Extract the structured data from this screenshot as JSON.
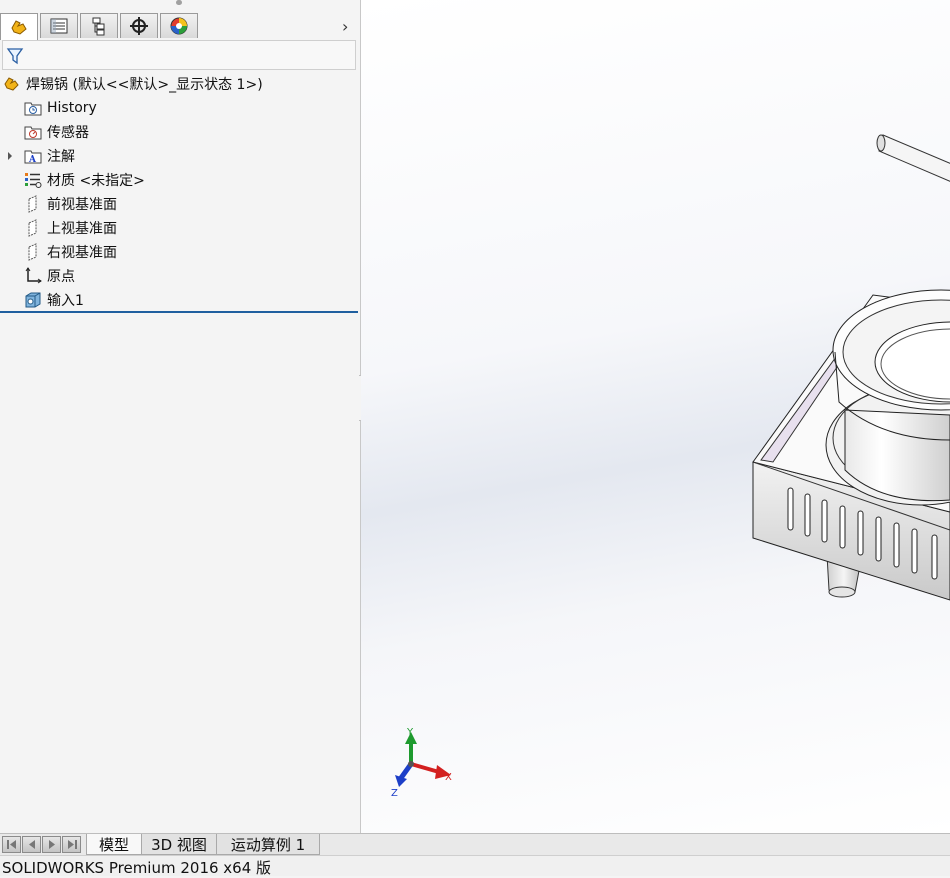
{
  "tabs": [
    {
      "icon": "feature-manager-icon",
      "active": true
    },
    {
      "icon": "property-manager-icon",
      "active": false
    },
    {
      "icon": "configuration-manager-icon",
      "active": false
    },
    {
      "icon": "dimxpert-icon",
      "active": false
    },
    {
      "icon": "display-manager-icon",
      "active": false
    }
  ],
  "tabs_more_icon": "chevron-right-icon",
  "filter_icon": "filter-icon",
  "tree": {
    "root": {
      "label": "焊锡锅  (默认<<默认>_显示状态 1>)",
      "icon": "part-icon"
    },
    "items": [
      {
        "label": "History",
        "icon": "history-folder-icon"
      },
      {
        "label": "传感器",
        "icon": "sensor-folder-icon"
      },
      {
        "label": "注解",
        "icon": "annotation-folder-icon",
        "expandable": true
      },
      {
        "label": "材质 <未指定>",
        "icon": "material-icon"
      },
      {
        "label": "前视基准面",
        "icon": "plane-icon"
      },
      {
        "label": "上视基准面",
        "icon": "plane-icon"
      },
      {
        "label": "右视基准面",
        "icon": "plane-icon"
      },
      {
        "label": "原点",
        "icon": "origin-icon"
      },
      {
        "label": "输入1",
        "icon": "imported-body-icon"
      }
    ]
  },
  "triad": {
    "x": "X",
    "y": "Y",
    "z": "Z",
    "colors": {
      "x": "#d32020",
      "y": "#1e9a2e",
      "z": "#1d3fc8"
    }
  },
  "bottom_tabs": {
    "labels": [
      "模型",
      "3D 视图",
      "运动算例 1"
    ],
    "active": "模型"
  },
  "status_bar": {
    "text": "SOLIDWORKS Premium 2016 x64 版"
  }
}
